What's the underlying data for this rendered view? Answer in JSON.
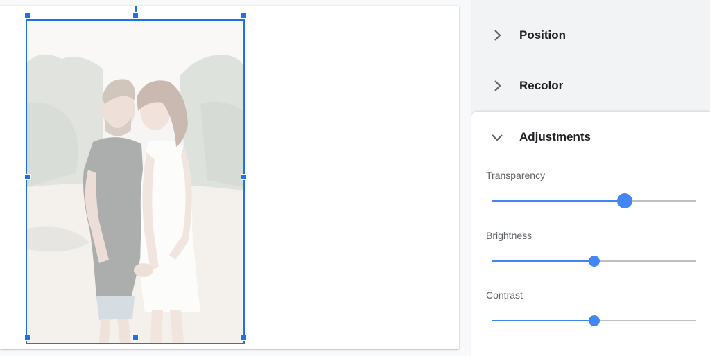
{
  "image": {
    "description_icon": "photo-icon"
  },
  "panel": {
    "sections": [
      {
        "label": "Position",
        "expanded": false,
        "icon": "chevron-right-icon"
      },
      {
        "label": "Recolor",
        "expanded": false,
        "icon": "chevron-right-icon"
      },
      {
        "label": "Adjustments",
        "expanded": true,
        "icon": "chevron-down-icon"
      }
    ],
    "adjustments": {
      "transparency": {
        "label": "Transparency",
        "value": 0.65
      },
      "brightness": {
        "label": "Brightness",
        "value": 0.5
      },
      "contrast": {
        "label": "Contrast",
        "value": 0.5
      }
    }
  },
  "colors": {
    "accent": "#4285f4",
    "selection": "#1a73e8",
    "track": "#bdc1c6"
  }
}
